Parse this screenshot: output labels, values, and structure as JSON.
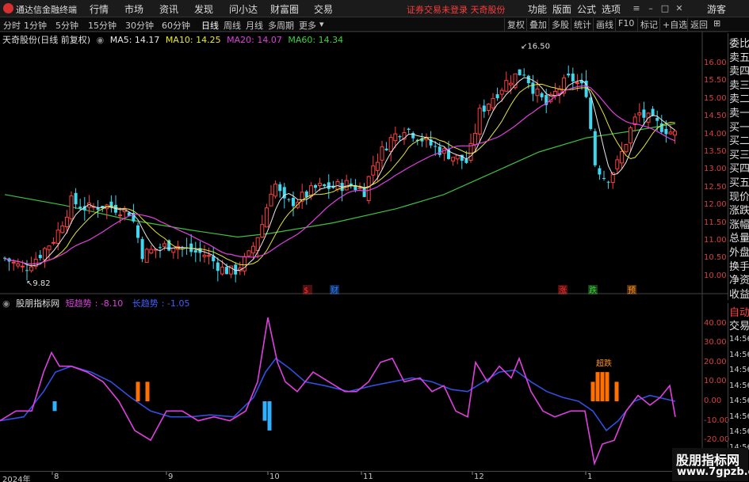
{
  "app": {
    "title": "通达信金融终端",
    "menu": [
      "行情",
      "市场",
      "资讯",
      "发现",
      "问小达",
      "财富圈",
      "交易"
    ],
    "notice": "证券交易未登录  天奇股份",
    "right_menu": [
      "功能",
      "版面",
      "公式",
      "选项"
    ],
    "visitor": "游客"
  },
  "toolbar": {
    "periods": [
      "分时",
      "1分钟",
      "5分钟",
      "15分钟",
      "30分钟",
      "60分钟",
      "日线",
      "周线",
      "月线",
      "多周期",
      "更多"
    ],
    "active_period": "日线",
    "buttons": [
      "复权",
      "叠加",
      "多股",
      "统计",
      "画线",
      "F10",
      "标记",
      "+自选",
      "返回"
    ]
  },
  "price_panel": {
    "stock_label": "天奇股份(日线 前复权)",
    "ma_labels": [
      {
        "text": "MA5: 14.17",
        "color": "#e8e8e8"
      },
      {
        "text": "MA10: 14.25",
        "color": "#e8e830"
      },
      {
        "text": "MA20: 14.07",
        "color": "#e040e0"
      },
      {
        "text": "MA60: 14.34",
        "color": "#40d040"
      }
    ],
    "axis_ticks": [
      "16.00",
      "15.50",
      "15.00",
      "14.50",
      "14.00",
      "13.50",
      "13.00",
      "12.50",
      "12.00",
      "11.50",
      "11.00",
      "10.50",
      "10.00"
    ],
    "high_label": "16.50",
    "low_label": "9.82",
    "event_marks": [
      "$",
      "财",
      "涨",
      "跌",
      "预"
    ]
  },
  "side_panel": {
    "items": [
      "委比",
      "卖五",
      "卖四",
      "卖三",
      "卖二",
      "卖一",
      "买一",
      "买二",
      "买三",
      "买四",
      "买五",
      "现价",
      "涨跌",
      "涨幅",
      "总量",
      "外盘",
      "换手",
      "净资",
      "收益"
    ]
  },
  "indicator": {
    "name": "股朋指标网",
    "short_label": "短趋势",
    "short_value": "-8.10",
    "long_label": "长趋势",
    "long_value": "-1.05",
    "axis_ticks": [
      "40.00",
      "30.00",
      "20.00",
      "10.00",
      "0.00",
      "-10.00",
      "-20.00"
    ],
    "annotation": "超跌",
    "colors": {
      "short": "#e040e0",
      "long": "#3050e0",
      "bar_up": "#ff7000",
      "bar_down": "#30b0ff"
    }
  },
  "side_panel2": {
    "items": [
      "自动",
      "交易"
    ],
    "times": [
      "14:56",
      "14:56",
      "14:56",
      "14:56",
      "14:56",
      "14:56",
      "14:56",
      "14:56"
    ]
  },
  "xaxis": {
    "labels": [
      "2024年",
      "8",
      "9",
      "10",
      "11",
      "12",
      "1"
    ]
  },
  "watermark": {
    "line1": "股朋指标网",
    "line2": "www.7gpzb.com"
  }
}
